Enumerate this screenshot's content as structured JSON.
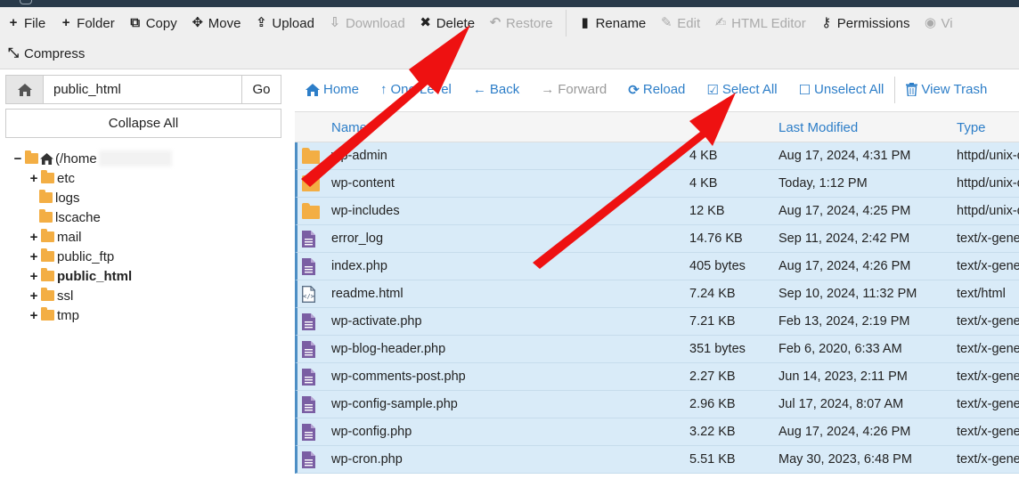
{
  "toolbar": {
    "row1": [
      {
        "label": "File",
        "icon": "plus-icon",
        "disabled": false
      },
      {
        "label": "Folder",
        "icon": "plus-icon",
        "disabled": false
      },
      {
        "label": "Copy",
        "icon": "copy-icon",
        "disabled": false
      },
      {
        "label": "Move",
        "icon": "move-icon",
        "disabled": false
      },
      {
        "label": "Upload",
        "icon": "upload-icon",
        "disabled": false
      },
      {
        "label": "Download",
        "icon": "download-icon",
        "disabled": true
      },
      {
        "label": "Delete",
        "icon": "close-icon",
        "disabled": false
      },
      {
        "label": "Restore",
        "icon": "restore-icon",
        "disabled": true
      },
      {
        "label": "Rename",
        "icon": "file-icon",
        "disabled": false
      },
      {
        "label": "Edit",
        "icon": "pencil-icon",
        "disabled": true
      },
      {
        "label": "HTML Editor",
        "icon": "edit-square-icon",
        "disabled": true
      },
      {
        "label": "Permissions",
        "icon": "key-icon",
        "disabled": false
      },
      {
        "label": "Vi",
        "icon": "eye-icon",
        "disabled": true
      }
    ],
    "row2": [
      {
        "label": "Compress",
        "icon": "compress-icon",
        "disabled": false
      }
    ]
  },
  "address": {
    "value": "public_html",
    "go_label": "Go"
  },
  "collapse_label": "Collapse All",
  "tree": {
    "root": {
      "toggle": "−",
      "label": "(/home"
    },
    "items": [
      {
        "label": "etc",
        "toggle": "+",
        "bold": false
      },
      {
        "label": "logs",
        "toggle": "",
        "bold": false
      },
      {
        "label": "lscache",
        "toggle": "",
        "bold": false
      },
      {
        "label": "mail",
        "toggle": "+",
        "bold": false
      },
      {
        "label": "public_ftp",
        "toggle": "+",
        "bold": false
      },
      {
        "label": "public_html",
        "toggle": "+",
        "bold": true
      },
      {
        "label": "ssl",
        "toggle": "+",
        "bold": false
      },
      {
        "label": "tmp",
        "toggle": "+",
        "bold": false
      }
    ]
  },
  "nav": {
    "home": "Home",
    "up": "One Level",
    "back": "Back",
    "forward": "Forward",
    "reload": "Reload",
    "select_all": "Select All",
    "unselect_all": "Unselect All",
    "trash": "View Trash"
  },
  "table": {
    "headers": {
      "name": "Name",
      "modified": "Last Modified",
      "type": "Type"
    },
    "rows": [
      {
        "name": "wp-admin",
        "size": "4 KB",
        "modified": "Aug 17, 2024, 4:31 PM",
        "type": "httpd/unix-d",
        "kind": "folder"
      },
      {
        "name": "wp-content",
        "size": "4 KB",
        "modified": "Today, 1:12 PM",
        "type": "httpd/unix-d",
        "kind": "folder"
      },
      {
        "name": "wp-includes",
        "size": "12 KB",
        "modified": "Aug 17, 2024, 4:25 PM",
        "type": "httpd/unix-d",
        "kind": "folder"
      },
      {
        "name": "error_log",
        "size": "14.76 KB",
        "modified": "Sep 11, 2024, 2:42 PM",
        "type": "text/x-gene",
        "kind": "file"
      },
      {
        "name": "index.php",
        "size": "405 bytes",
        "modified": "Aug 17, 2024, 4:26 PM",
        "type": "text/x-gene",
        "kind": "file"
      },
      {
        "name": "readme.html",
        "size": "7.24 KB",
        "modified": "Sep 10, 2024, 11:32 PM",
        "type": "text/html",
        "kind": "html"
      },
      {
        "name": "wp-activate.php",
        "size": "7.21 KB",
        "modified": "Feb 13, 2024, 2:19 PM",
        "type": "text/x-gene",
        "kind": "file"
      },
      {
        "name": "wp-blog-header.php",
        "size": "351 bytes",
        "modified": "Feb 6, 2020, 6:33 AM",
        "type": "text/x-gene",
        "kind": "file"
      },
      {
        "name": "wp-comments-post.php",
        "size": "2.27 KB",
        "modified": "Jun 14, 2023, 2:11 PM",
        "type": "text/x-gene",
        "kind": "file"
      },
      {
        "name": "wp-config-sample.php",
        "size": "2.96 KB",
        "modified": "Jul 17, 2024, 8:07 AM",
        "type": "text/x-gene",
        "kind": "file"
      },
      {
        "name": "wp-config.php",
        "size": "3.22 KB",
        "modified": "Aug 17, 2024, 4:26 PM",
        "type": "text/x-gene",
        "kind": "file"
      },
      {
        "name": "wp-cron.php",
        "size": "5.51 KB",
        "modified": "May 30, 2023, 6:48 PM",
        "type": "text/x-gene",
        "kind": "file"
      }
    ]
  },
  "colors": {
    "link": "#2d7ec8",
    "selected_row": "#d9ebf8",
    "folder": "#f3ae44",
    "file_icon": "#7a5ea3",
    "arrow": "#ee1111"
  }
}
